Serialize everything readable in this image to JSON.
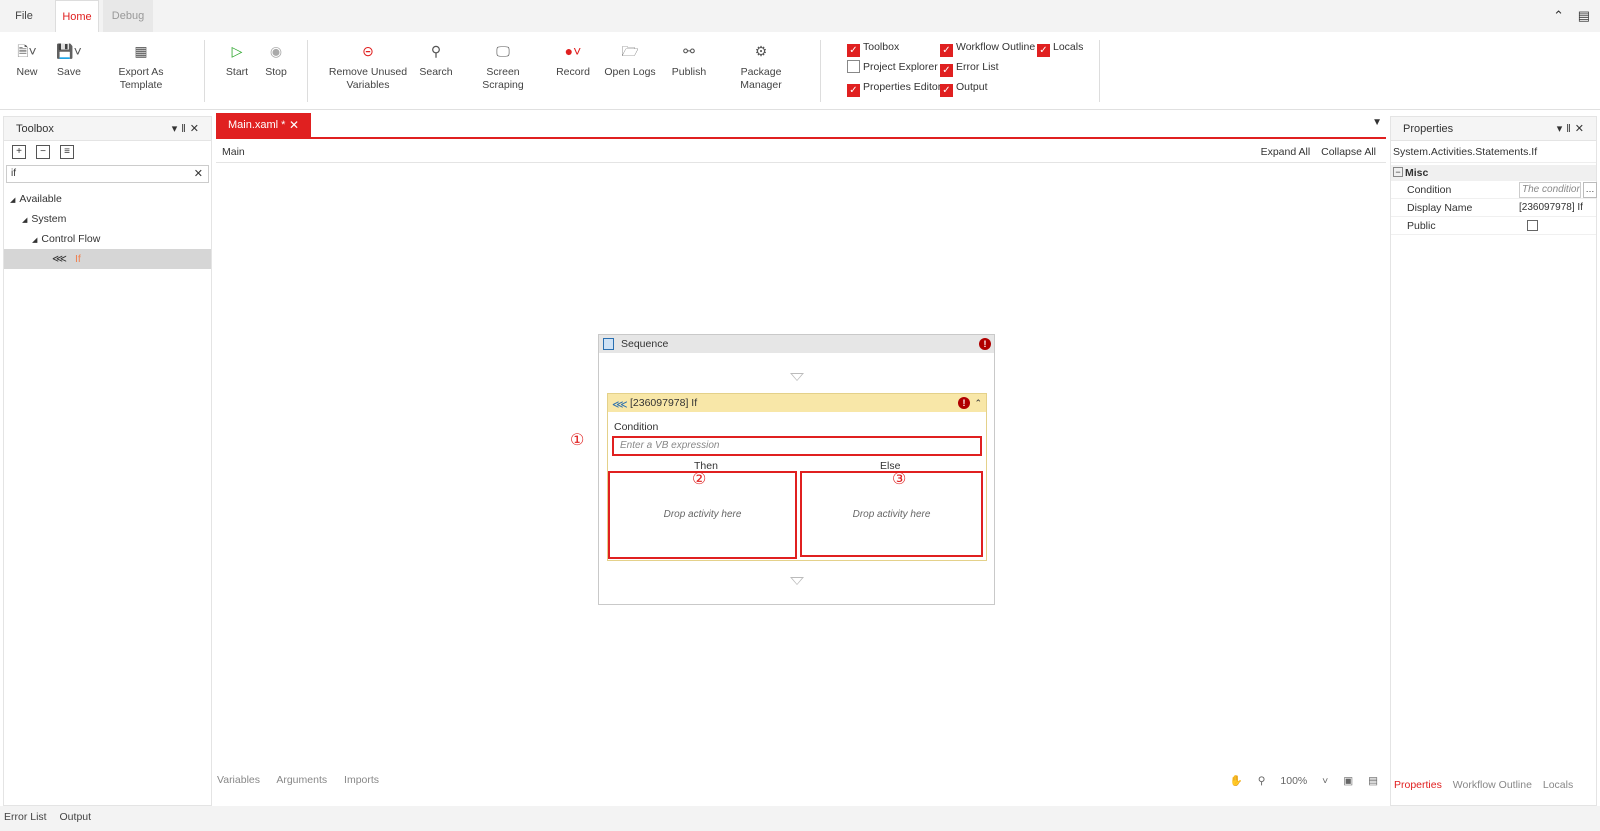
{
  "menu_tabs": [
    {
      "label": "File"
    },
    {
      "label": "Home"
    },
    {
      "label": "Debug"
    }
  ],
  "ribbon": {
    "new": "New",
    "save": "Save",
    "export_template": "Export As Template",
    "start": "Start",
    "stop": "Stop",
    "remove_unused_line1": "Remove Unused",
    "remove_unused_line2": "Variables",
    "search": "Search",
    "screen_scraping": "Screen Scraping",
    "record": "Record",
    "open_logs": "Open Logs",
    "publish": "Publish",
    "package_manager": "Package Manager"
  },
  "view_checks": [
    {
      "label": "Toolbox",
      "checked": true
    },
    {
      "label": "Project Explorer",
      "checked": false
    },
    {
      "label": "Properties Editor",
      "checked": true
    },
    {
      "label": "Workflow Outline",
      "checked": true
    },
    {
      "label": "Error List",
      "checked": true
    },
    {
      "label": "Output",
      "checked": true
    },
    {
      "label": "Locals",
      "checked": true
    }
  ],
  "toolbox": {
    "title": "Toolbox",
    "search_value": "if",
    "tree": [
      {
        "label": "Available"
      },
      {
        "label": "System"
      },
      {
        "label": "Control Flow"
      },
      {
        "label": "If"
      }
    ]
  },
  "document": {
    "tab_label": "Main.xaml *",
    "breadcrumb": "Main",
    "expand_all": "Expand All",
    "collapse_all": "Collapse All"
  },
  "workflow": {
    "sequence_title": "Sequence",
    "if_title": "[236097978] If",
    "condition_label": "Condition",
    "condition_placeholder": "Enter a VB expression",
    "then_label": "Then",
    "else_label": "Else",
    "drop_then": "Drop activity here",
    "drop_else": "Drop activity here",
    "marker_1": "①",
    "marker_2": "②",
    "marker_3": "③"
  },
  "canvas_bottom": {
    "variables": "Variables",
    "arguments": "Arguments",
    "imports": "Imports",
    "zoom": "100%"
  },
  "properties": {
    "title": "Properties",
    "type_name": "System.Activities.Statements.If",
    "group": "Misc",
    "rows": [
      {
        "key": "Condition",
        "value": "The condition"
      },
      {
        "key": "Display Name",
        "value": "[236097978] If"
      },
      {
        "key": "Public",
        "value": ""
      }
    ],
    "tabs": [
      "Properties",
      "Workflow Outline",
      "Locals"
    ]
  },
  "status_tabs": [
    "Error List",
    "Output"
  ],
  "colors": {
    "accent": "#e02020",
    "if_header": "#f8e7a8"
  }
}
